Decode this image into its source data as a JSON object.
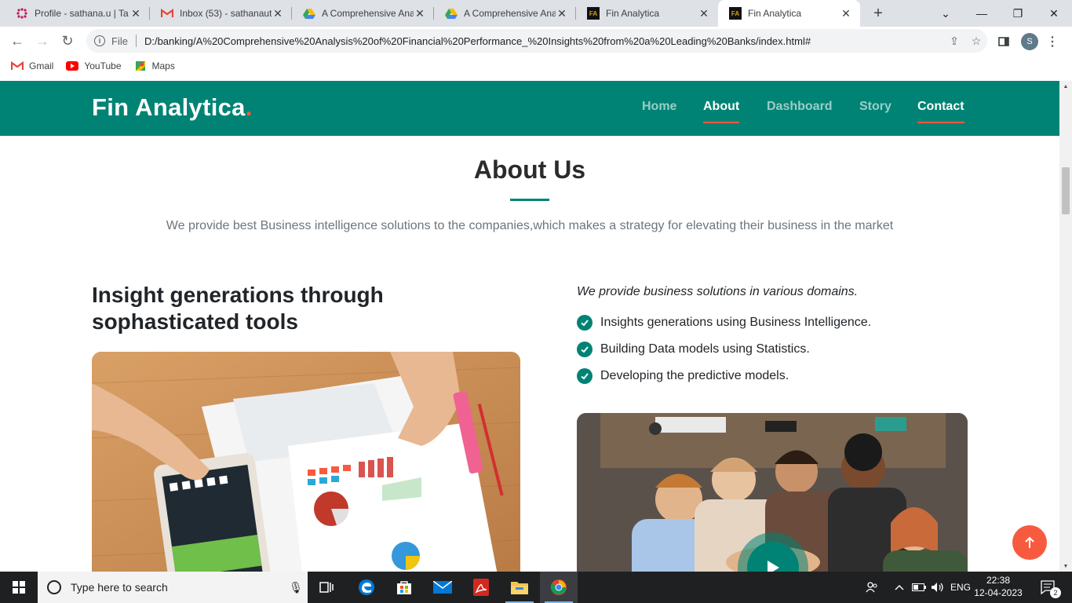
{
  "browser": {
    "tabs": [
      {
        "title": "Profile - sathana.u | Ta",
        "favicon": "grid-favicon",
        "active": false
      },
      {
        "title": "Inbox (53) - sathanaut",
        "favicon": "gmail-favicon",
        "active": false
      },
      {
        "title": "A Comprehensive Ana",
        "favicon": "drive-favicon",
        "active": false
      },
      {
        "title": "A Comprehensive Ana",
        "favicon": "drive-favicon",
        "active": false
      },
      {
        "title": "Fin Analytica",
        "favicon": "fin-favicon",
        "active": false
      },
      {
        "title": "Fin Analytica",
        "favicon": "fin-favicon",
        "active": true
      }
    ],
    "scheme_label": "File",
    "url": "D:/banking/A%20Comprehensive%20Analysis%20of%20Financial%20Performance_%20Insights%20from%20a%20Leading%20Banks/index.html#",
    "profile_initial": "S",
    "bookmarks": [
      {
        "label": "Gmail",
        "icon": "gmail-icon"
      },
      {
        "label": "YouTube",
        "icon": "youtube-icon"
      },
      {
        "label": "Maps",
        "icon": "maps-icon"
      }
    ]
  },
  "site": {
    "logo": "Fin Analytica",
    "logo_dot": ".",
    "nav": [
      {
        "label": "Home",
        "active": false
      },
      {
        "label": "About",
        "active": true
      },
      {
        "label": "Dashboard",
        "active": false
      },
      {
        "label": "Story",
        "active": false
      },
      {
        "label": "Contact",
        "active": true
      }
    ]
  },
  "about": {
    "title": "About Us",
    "subtitle": "We provide best Business intelligence solutions to the companies,which makes a strategy for elevating their business in the market",
    "left_heading_line1": "Insight generations through",
    "left_heading_line2": "sophasticated tools",
    "right_intro": "We provide business solutions in various domains.",
    "features": [
      "Insights generations using Business Intelligence.",
      "Building Data models using Statistics.",
      "Developing the predictive models."
    ]
  },
  "taskbar": {
    "search_placeholder": "Type here to search",
    "language": "ENG",
    "time": "22:38",
    "date": "12-04-2023",
    "notifications": "2"
  },
  "colors": {
    "brand": "#008374",
    "accent": "#f85a40"
  }
}
